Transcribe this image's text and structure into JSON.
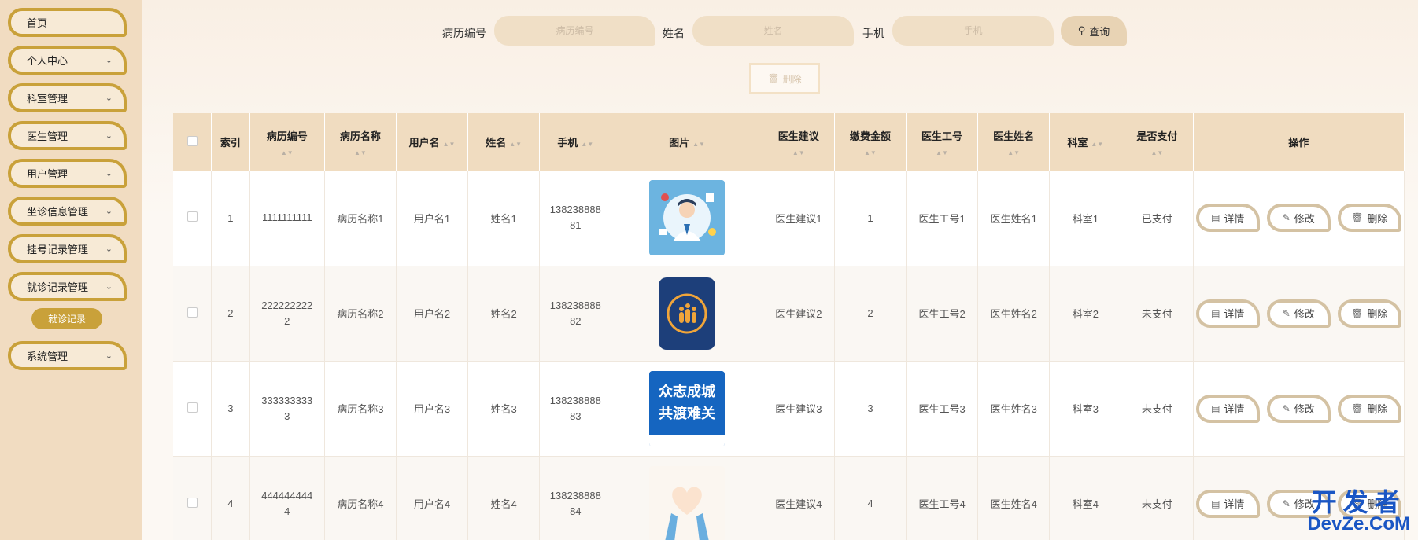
{
  "sidebar": {
    "items": [
      {
        "label": "首页",
        "has_chevron": false
      },
      {
        "label": "个人中心",
        "has_chevron": true
      },
      {
        "label": "科室管理",
        "has_chevron": true
      },
      {
        "label": "医生管理",
        "has_chevron": true
      },
      {
        "label": "用户管理",
        "has_chevron": true
      },
      {
        "label": "坐诊信息管理",
        "has_chevron": true
      },
      {
        "label": "挂号记录管理",
        "has_chevron": true
      },
      {
        "label": "就诊记录管理",
        "has_chevron": true
      },
      {
        "label": "系统管理",
        "has_chevron": true
      }
    ],
    "sub_item": "就诊记录"
  },
  "search": {
    "record_no_label": "病历编号",
    "record_no_placeholder": "病历编号",
    "name_label": "姓名",
    "name_placeholder": "姓名",
    "phone_label": "手机",
    "phone_placeholder": "手机",
    "query_label": "查询"
  },
  "toolbar": {
    "delete_label": "删除"
  },
  "table": {
    "headers": [
      "索引",
      "病历编号",
      "病历名称",
      "用户名",
      "姓名",
      "手机",
      "图片",
      "医生建议",
      "缴费金额",
      "医生工号",
      "医生姓名",
      "科室",
      "是否支付",
      "操作"
    ],
    "rows": [
      {
        "index": "1",
        "record_no": "1111111111",
        "record_name": "病历名称1",
        "username": "用户名1",
        "name": "姓名1",
        "phone": "13823888881",
        "advice": "医生建议1",
        "amount": "1",
        "doctor_no": "医生工号1",
        "doctor_name": "医生姓名1",
        "dept": "科室1",
        "paid": "已支付"
      },
      {
        "index": "2",
        "record_no": "2222222222",
        "record_name": "病历名称2",
        "username": "用户名2",
        "name": "姓名2",
        "phone": "13823888882",
        "advice": "医生建议2",
        "amount": "2",
        "doctor_no": "医生工号2",
        "doctor_name": "医生姓名2",
        "dept": "科室2",
        "paid": "未支付"
      },
      {
        "index": "3",
        "record_no": "3333333333",
        "record_name": "病历名称3",
        "username": "用户名3",
        "name": "姓名3",
        "phone": "13823888883",
        "advice": "医生建议3",
        "amount": "3",
        "doctor_no": "医生工号3",
        "doctor_name": "医生姓名3",
        "dept": "科室3",
        "paid": "未支付"
      },
      {
        "index": "4",
        "record_no": "4444444444",
        "record_name": "病历名称4",
        "username": "用户名4",
        "name": "姓名4",
        "phone": "13823888884",
        "advice": "医生建议4",
        "amount": "4",
        "doctor_no": "医生工号4",
        "doctor_name": "医生姓名4",
        "dept": "科室4",
        "paid": "未支付"
      }
    ],
    "row_images": [
      "doctor-illustration",
      "app-icon",
      "poster-text",
      "heart-hands"
    ],
    "poster_text": [
      "众志成城",
      "共渡难关"
    ],
    "actions": {
      "detail": "详情",
      "edit": "修改",
      "delete": "删除"
    }
  },
  "watermark": {
    "line1": "开发者",
    "line2": "DevZe.CoM"
  },
  "colors": {
    "accent": "#c9a13a",
    "sidebar_bg": "#f1dcc1",
    "header_bg": "#f0dcc0"
  }
}
